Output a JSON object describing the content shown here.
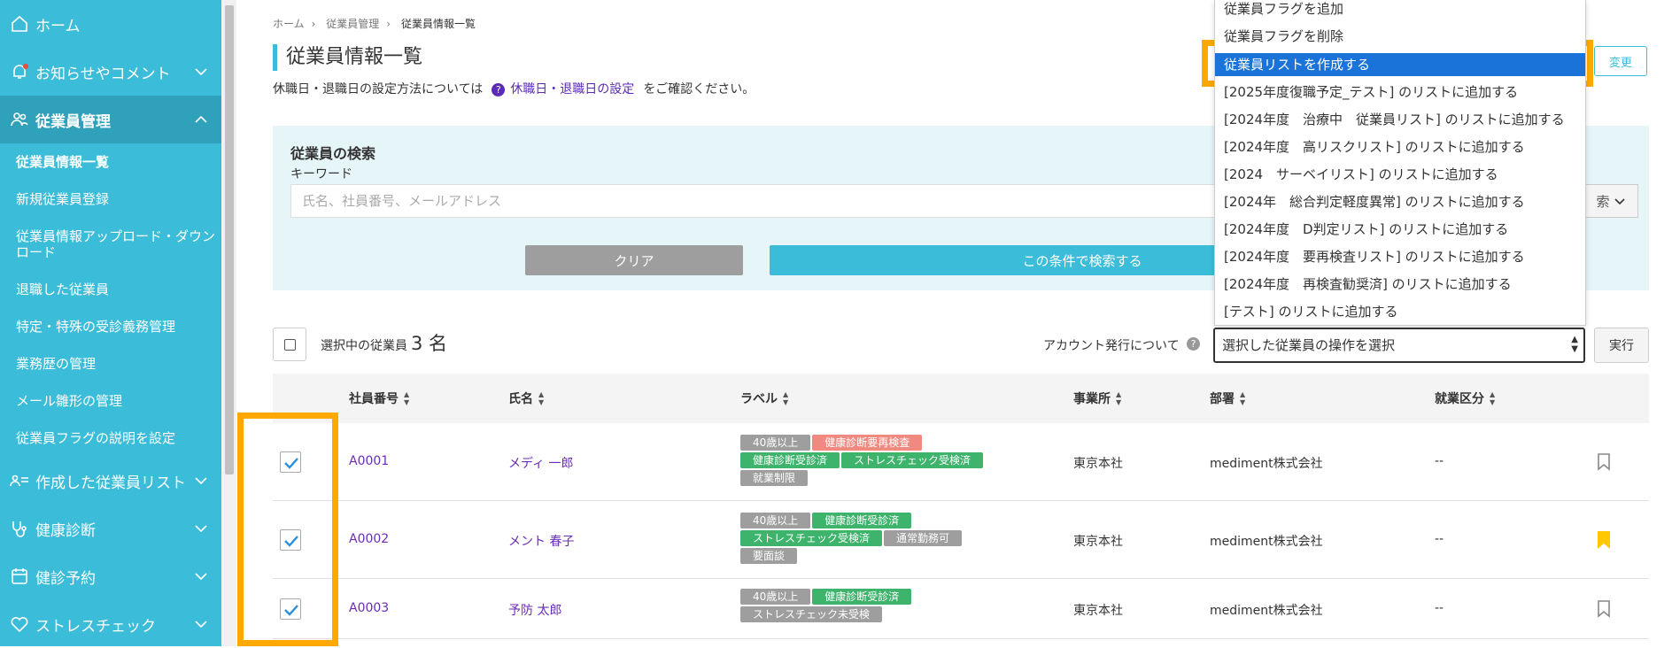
{
  "sidebar": {
    "home": "ホーム",
    "notices": "お知らせやコメント",
    "employee_mgmt": "従業員管理",
    "sub_items": [
      "従業員情報一覧",
      "新規従業員登録",
      "従業員情報アップロード・ダウンロード",
      "退職した従業員",
      "特定・特殊の受診義務管理",
      "業務歴の管理",
      "メール雛形の管理",
      "従業員フラグの説明を設定"
    ],
    "created_lists": "作成した従業員リスト",
    "health_check": "健康診断",
    "checkup_booking": "健診予約",
    "stress_check": "ストレスチェック"
  },
  "breadcrumb": [
    "ホーム",
    "従業員管理",
    "従業員情報一覧"
  ],
  "page_title": "従業員情報一覧",
  "notice": {
    "before": "休職日・退職日の設定方法については",
    "link": "休職日・退職日の設定",
    "after": "をご確認ください。"
  },
  "change_button": "変更",
  "search": {
    "title": "従業員の検索",
    "keyword_label": "キーワード",
    "placeholder": "氏名、社員番号、メールアドレス",
    "detail_toggle": "索",
    "clear": "クリア",
    "submit": "この条件で検索する"
  },
  "selection": {
    "label": "選択中の従業員",
    "count": "3 名",
    "account_label": "アカウント発行について",
    "operation_select": "選択した従業員の操作を選択",
    "execute": "実行"
  },
  "table": {
    "headers": [
      "社員番号",
      "氏名",
      "ラベル",
      "事業所",
      "部署",
      "就業区分"
    ],
    "rows": [
      {
        "id": "A0001",
        "name": "メディ 一郎",
        "office": "東京本社",
        "dept": "mediment株式会社",
        "work_type": "--",
        "bookmarked": false,
        "checked": true,
        "tags": [
          {
            "text": "40歳以上",
            "color": "gray"
          },
          {
            "text": "健康診断要再検査",
            "color": "red"
          },
          {
            "text": "健康診断受診済",
            "color": "green"
          },
          {
            "text": "ストレスチェック受検済",
            "color": "green"
          },
          {
            "text": "就業制限",
            "color": "gray"
          }
        ]
      },
      {
        "id": "A0002",
        "name": "メント 春子",
        "office": "東京本社",
        "dept": "mediment株式会社",
        "work_type": "--",
        "bookmarked": true,
        "checked": true,
        "tags": [
          {
            "text": "40歳以上",
            "color": "gray"
          },
          {
            "text": "健康診断受診済",
            "color": "green"
          },
          {
            "text": "ストレスチェック受検済",
            "color": "green"
          },
          {
            "text": "通常勤務可",
            "color": "gray"
          },
          {
            "text": "要面談",
            "color": "gray"
          }
        ]
      },
      {
        "id": "A0003",
        "name": "予防 太郎",
        "office": "東京本社",
        "dept": "mediment株式会社",
        "work_type": "--",
        "bookmarked": false,
        "checked": true,
        "tags": [
          {
            "text": "40歳以上",
            "color": "gray"
          },
          {
            "text": "健康診断受診済",
            "color": "green"
          },
          {
            "text": "ストレスチェック未受検",
            "color": "gray"
          }
        ]
      }
    ]
  },
  "dropdown": {
    "options": [
      "従業員フラグを追加",
      "従業員フラグを削除",
      "従業員リストを作成する",
      "[2025年度復職予定_テスト] のリストに追加する",
      "[2024年度　治療中　従業員リスト] のリストに追加する",
      "[2024年度　高リスクリスト] のリストに追加する",
      "[2024　サーベイリスト] のリストに追加する",
      "[2024年　総合判定軽度異常] のリストに追加する",
      "[2024年度　D判定リスト] のリストに追加する",
      "[2024年度　要再検査リスト] のリストに追加する",
      "[2024年度　再検査勧奨済] のリストに追加する",
      "[テスト] のリストに追加する"
    ],
    "selected_index": 2
  },
  "colors": {
    "sidebar": "#3bbcd8",
    "sidebar_active": "#2fa1bb",
    "accent": "#3bbcd8",
    "highlight": "#ffa800",
    "link": "#6a2bb8",
    "selected_option": "#1a73d9"
  }
}
